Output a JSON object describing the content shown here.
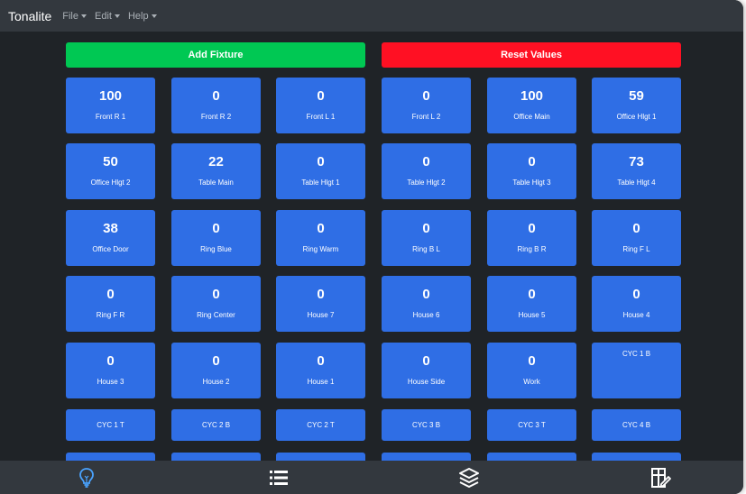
{
  "app": {
    "title": "Tonalite"
  },
  "menu": [
    {
      "label": "File"
    },
    {
      "label": "Edit"
    },
    {
      "label": "Help"
    }
  ],
  "actions": {
    "add_label": "Add Fixture",
    "reset_label": "Reset Values"
  },
  "colors": {
    "add": "#00c853",
    "reset": "#ff1023",
    "tile": "#2f6ee5",
    "nav_active": "#4aa3ff"
  },
  "fixtures": [
    {
      "value": "100",
      "name": "Front R 1"
    },
    {
      "value": "0",
      "name": "Front R 2"
    },
    {
      "value": "0",
      "name": "Front L 1"
    },
    {
      "value": "0",
      "name": "Front L 2"
    },
    {
      "value": "100",
      "name": "Office Main"
    },
    {
      "value": "59",
      "name": "Office Hlgt 1"
    },
    {
      "value": "50",
      "name": "Office Hlgt 2"
    },
    {
      "value": "22",
      "name": "Table Main"
    },
    {
      "value": "0",
      "name": "Table Hlgt 1"
    },
    {
      "value": "0",
      "name": "Table Hlgt 2"
    },
    {
      "value": "0",
      "name": "Table Hlgt 3"
    },
    {
      "value": "73",
      "name": "Table Hlgt 4"
    },
    {
      "value": "38",
      "name": "Office Door"
    },
    {
      "value": "0",
      "name": "Ring Blue"
    },
    {
      "value": "0",
      "name": "Ring Warm"
    },
    {
      "value": "0",
      "name": "Ring B L"
    },
    {
      "value": "0",
      "name": "Ring B R"
    },
    {
      "value": "0",
      "name": "Ring F L"
    },
    {
      "value": "0",
      "name": "Ring F R"
    },
    {
      "value": "0",
      "name": "Ring Center"
    },
    {
      "value": "0",
      "name": "House 7"
    },
    {
      "value": "0",
      "name": "House 6"
    },
    {
      "value": "0",
      "name": "House 5"
    },
    {
      "value": "0",
      "name": "House 4"
    },
    {
      "value": "0",
      "name": "House 3"
    },
    {
      "value": "0",
      "name": "House 2"
    },
    {
      "value": "0",
      "name": "House 1"
    },
    {
      "value": "0",
      "name": "House Side"
    },
    {
      "value": "0",
      "name": "Work"
    },
    {
      "value": "",
      "name": "CYC 1 B"
    },
    {
      "value": "",
      "name": "CYC 1 T"
    },
    {
      "value": "",
      "name": "CYC 2 B"
    },
    {
      "value": "",
      "name": "CYC 2 T"
    },
    {
      "value": "",
      "name": "CYC 3 B"
    },
    {
      "value": "",
      "name": "CYC 3 T"
    },
    {
      "value": "",
      "name": "CYC 4 B"
    },
    {
      "value": "",
      "name": ""
    },
    {
      "value": "",
      "name": ""
    },
    {
      "value": "",
      "name": ""
    },
    {
      "value": "",
      "name": ""
    },
    {
      "value": "",
      "name": ""
    },
    {
      "value": "",
      "name": ""
    }
  ],
  "bottom_nav": [
    {
      "icon": "lightbulb-icon",
      "active": true
    },
    {
      "icon": "list-icon",
      "active": false
    },
    {
      "icon": "layers-icon",
      "active": false
    },
    {
      "icon": "presets-icon",
      "active": false
    }
  ]
}
